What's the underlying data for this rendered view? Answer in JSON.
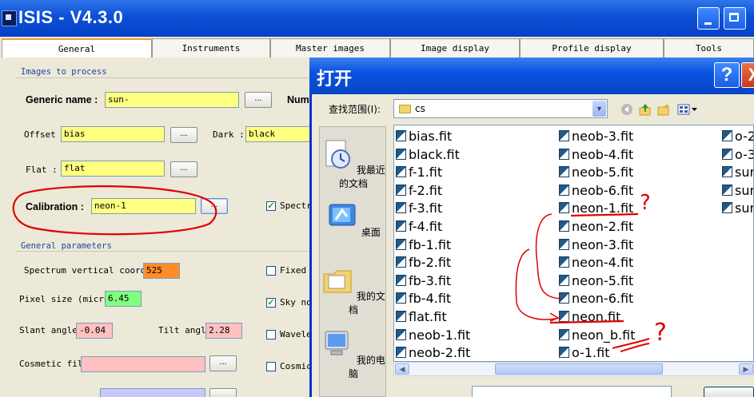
{
  "app": {
    "title": "ISIS - V4.3.0",
    "icon": "isis-app-icon"
  },
  "tabs": [
    "General",
    "Instruments",
    "Master images",
    "Image display",
    "Profile display",
    "Tools"
  ],
  "images_section": {
    "title": "Images to process",
    "generic_name_label": "Generic name :",
    "generic_name_value": "sun-",
    "num_label": "Num",
    "offset_label": "Offset",
    "offset_value": "bias",
    "dark_label": "Dark :",
    "dark_value": "black",
    "flat_label": "Flat :",
    "flat_value": "flat",
    "calibration_label": "Calibration :",
    "calibration_value": "neon-1",
    "browse_label": "...",
    "spectr_label": "Spectr"
  },
  "params_section": {
    "title": "General parameters",
    "spectrum_label": "Spectrum vertical coordi",
    "spectrum_value": "525",
    "pixel_label": "Pixel size (micro",
    "pixel_value": "6.45",
    "slant_label": "Slant angle",
    "slant_value": "-0.04",
    "tilt_label": "Tilt angl",
    "tilt_value": "2.28",
    "cosmetic_label": "Cosmetic fil",
    "fixed_label": "Fixed",
    "sky_label": "Sky no",
    "wavele_label": "Wavele",
    "cosmic_label": "Cosmic"
  },
  "dialog": {
    "title": "打开",
    "help": "?",
    "close": "X",
    "lookin_label": "查找范围(I):",
    "lookin_value": "cs",
    "places": [
      "我最近的文档",
      "桌面",
      "我的文档",
      "我的电脑"
    ],
    "files_col1": [
      "bias.fit",
      "black.fit",
      "f-1.fit",
      "f-2.fit",
      "f-3.fit",
      "f-4.fit",
      "fb-1.fit",
      "fb-2.fit",
      "fb-3.fit",
      "fb-4.fit",
      "flat.fit",
      "neob-1.fit",
      "neob-2.fit"
    ],
    "files_col2": [
      "neob-3.fit",
      "neob-4.fit",
      "neob-5.fit",
      "neob-6.fit",
      "neon-1.fit",
      "neon-2.fit",
      "neon-3.fit",
      "neon-4.fit",
      "neon-5.fit",
      "neon-6.fit",
      "neon.fit",
      "neon_b.fit",
      "o-1.fit"
    ],
    "files_col3": [
      "o-2",
      "o-3",
      "sur",
      "sur",
      "sur"
    ]
  },
  "annotations": {
    "q1": "?",
    "q2": "?",
    "color": "#e00000"
  }
}
